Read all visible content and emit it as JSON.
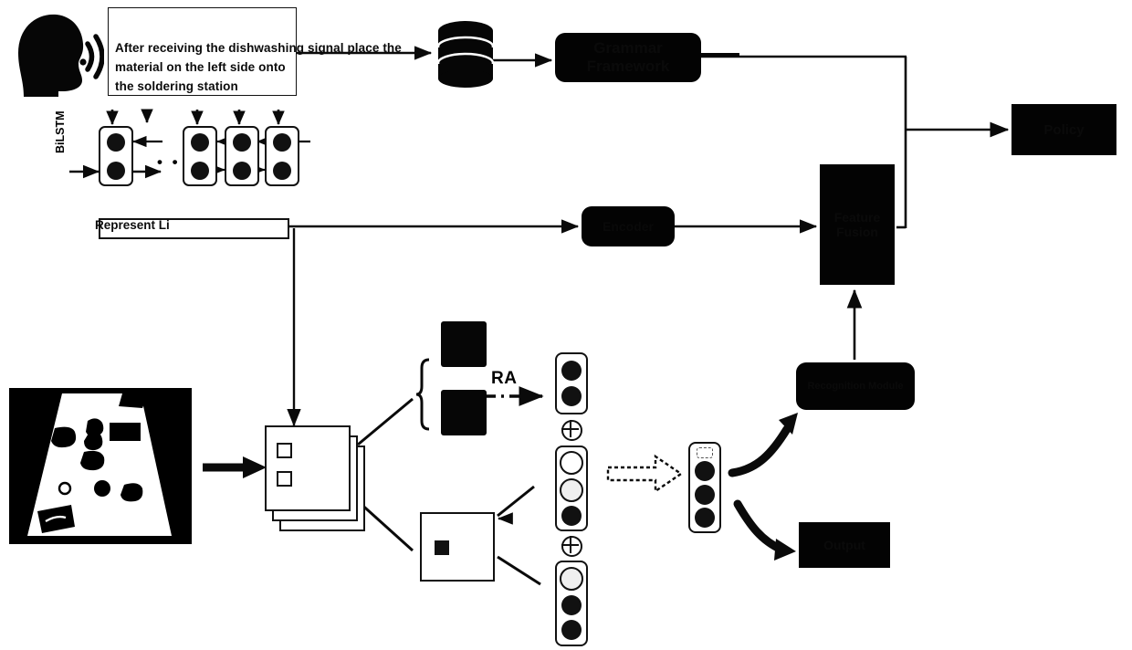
{
  "diagram": {
    "title_text": "After receiving the dishwashing signal place the material on the left side onto the soldering station",
    "instruction": {
      "line1": "After receiving the dishwashing signal place the",
      "line2": "material on the left side onto",
      "line3": "the soldering station"
    },
    "labels": {
      "bilstm": "BiLSTM",
      "represent": "Represent Li",
      "ra": "RA",
      "ellipsis": "• • •",
      "plus_symbol": "⊕"
    },
    "blocks": [
      {
        "id": "framework",
        "label": "Grammar Framework",
        "shape": "rounded-rect",
        "fill": "#030303"
      },
      {
        "id": "policy",
        "label": "Policy",
        "shape": "rect",
        "fill": "#030303"
      },
      {
        "id": "encoder",
        "label": "Encoder",
        "shape": "rounded-rect",
        "fill": "#030303"
      },
      {
        "id": "fusion",
        "label": "Feature Fusion",
        "shape": "rect",
        "fill": "#030303"
      },
      {
        "id": "recognition",
        "label": "Recognition\nModule",
        "shape": "rounded-rect",
        "fill": "#030303"
      },
      {
        "id": "output",
        "label": "Output",
        "shape": "rect",
        "fill": "#030303"
      }
    ],
    "icons": {
      "head": "speaking-head-icon",
      "waves": "sound-wave-icon",
      "database": "database-cylinder-icon",
      "photo": "workbench-scene-photo",
      "cards": "image-frame-stack"
    },
    "vectors": [
      {
        "id": "vec-ra",
        "cells": [
          "fill",
          "fill"
        ]
      },
      {
        "id": "vec-mid",
        "cells": [
          "hollow",
          "light",
          "fill"
        ]
      },
      {
        "id": "vec-bottom",
        "cells": [
          "light",
          "fill",
          "fill"
        ]
      },
      {
        "id": "vec-result",
        "cells": [
          "tiny",
          "fill",
          "fill",
          "fill"
        ]
      }
    ],
    "lstm": {
      "cell_count_left": 1,
      "cell_count_right": 3,
      "dots_per_cell": 2
    },
    "colors": {
      "ink": "#111111",
      "block_fill": "#030303",
      "paper": "#ffffff"
    }
  }
}
